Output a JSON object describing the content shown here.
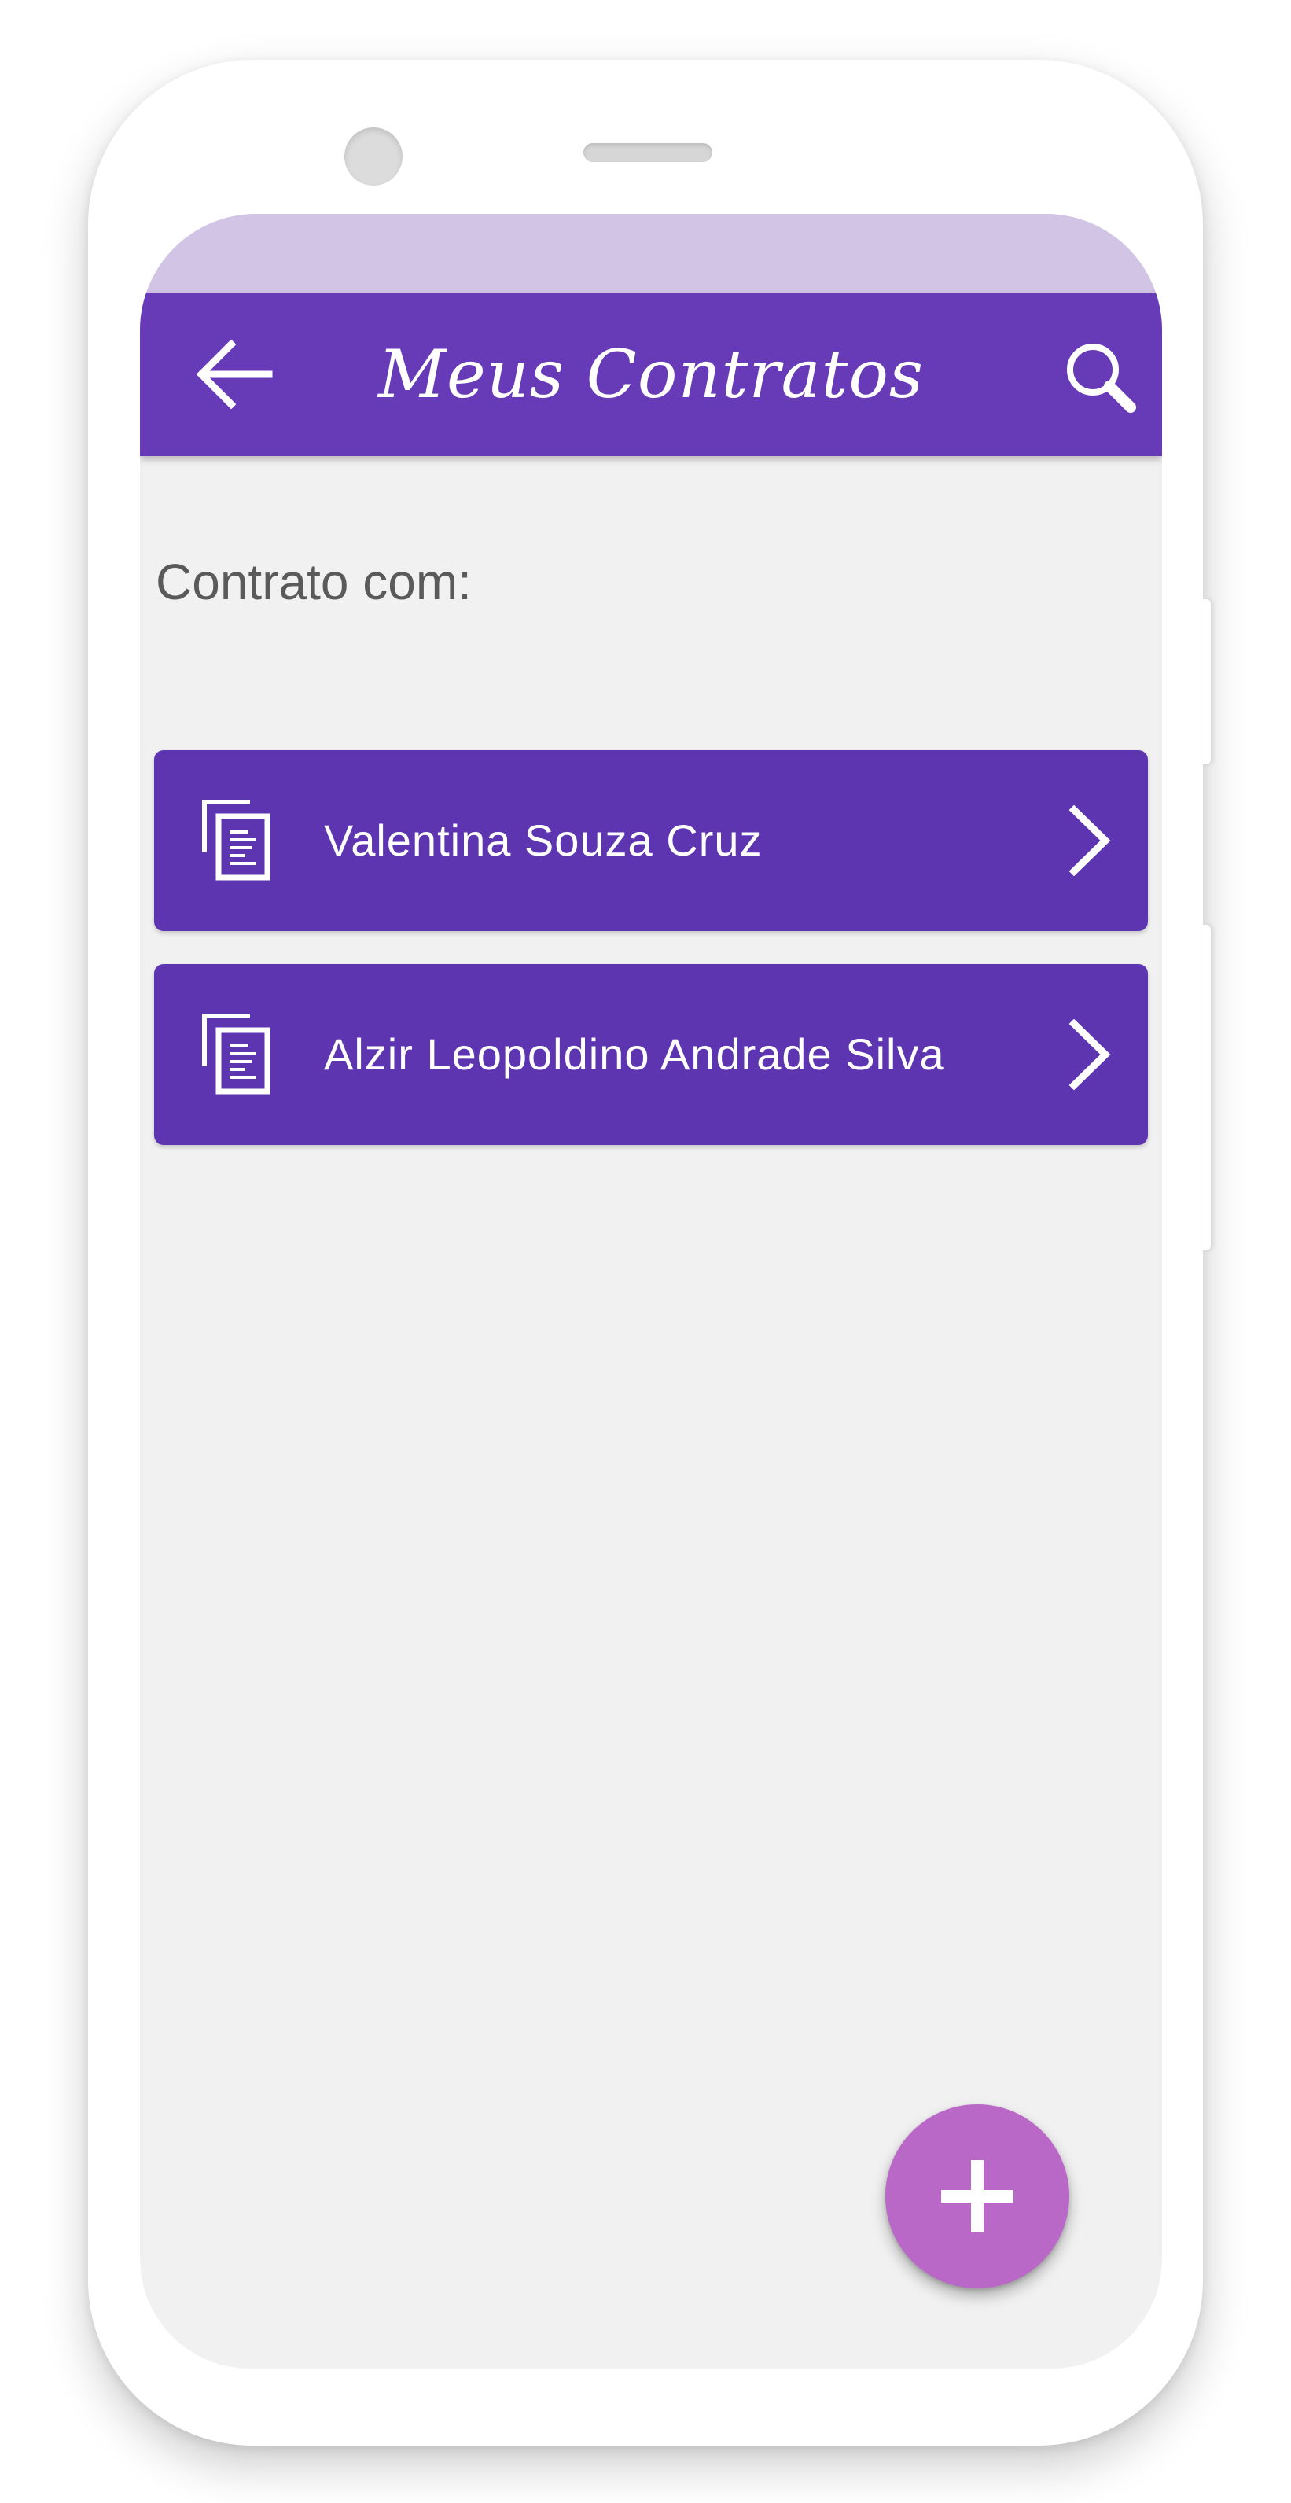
{
  "app_bar": {
    "title": "Meus Contratos",
    "back_icon": "arrow-left-icon",
    "search_icon": "search-icon",
    "color": "#673ab7"
  },
  "status_bar": {
    "color": "#d1c4e5"
  },
  "section": {
    "label": "Contrato com:"
  },
  "contracts": [
    {
      "name": "Valentina Souza Cruz",
      "icon": "document-copy-icon",
      "action_icon": "chevron-right-icon"
    },
    {
      "name": "Alzir Leopoldino Andrade Silva",
      "icon": "document-copy-icon",
      "action_icon": "chevron-right-icon"
    }
  ],
  "fab": {
    "icon": "plus-icon",
    "color": "#ba68c8"
  },
  "colors": {
    "list_item": "#5e35b1",
    "background": "#f1f1f1"
  }
}
